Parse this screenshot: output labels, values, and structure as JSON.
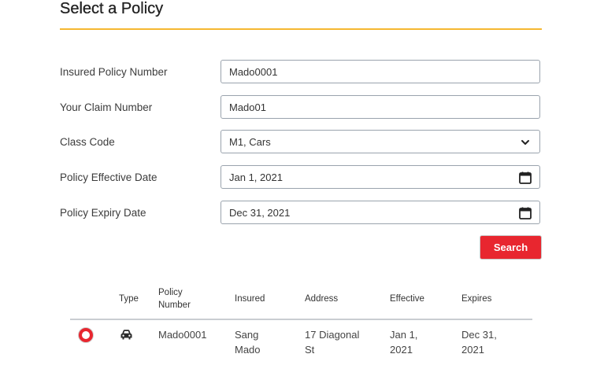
{
  "page": {
    "title": "Select a Policy"
  },
  "form": {
    "policy_number": {
      "label": "Insured Policy Number",
      "value": "Mado0001"
    },
    "claim_number": {
      "label": "Your Claim Number",
      "value": "Mado01"
    },
    "class_code": {
      "label": "Class Code",
      "value": "M1, Cars"
    },
    "effective_date": {
      "label": "Policy Effective Date",
      "value": "Jan 1, 2021"
    },
    "expiry_date": {
      "label": "Policy Expiry Date",
      "value": "Dec 31, 2021"
    },
    "search_label": "Search"
  },
  "table": {
    "headers": {
      "type": "Type",
      "policy_number_1": "Policy",
      "policy_number_2": "Number",
      "insured": "Insured",
      "address": "Address",
      "effective": "Effective",
      "expires": "Expires"
    },
    "rows": [
      {
        "type_icon": "car-icon",
        "policy_number": "Mado0001",
        "insured_1": "Sang",
        "insured_2": "Mado",
        "address_1": "17 Diagonal",
        "address_2": "St",
        "effective_1": "Jan 1,",
        "effective_2": "2021",
        "expires_1": "Dec 31,",
        "expires_2": "2021",
        "selected": true
      }
    ]
  },
  "colors": {
    "accent_rule": "#f5b731",
    "primary_button": "#e8262f"
  }
}
